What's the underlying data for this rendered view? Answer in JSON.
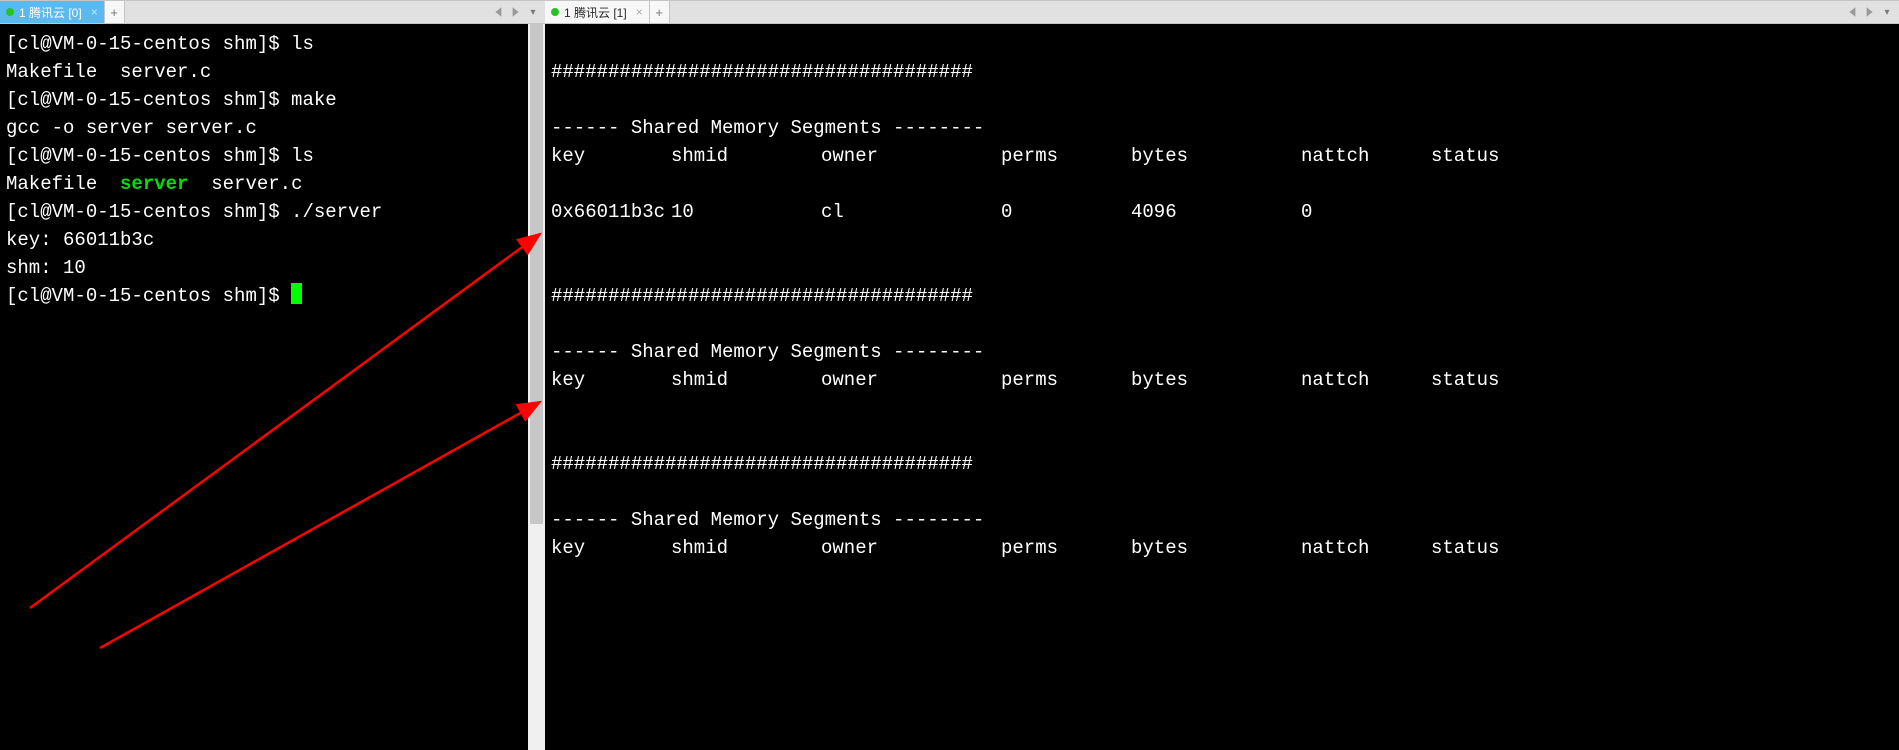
{
  "tabs": {
    "left": {
      "label": "1 腾讯云 [0]"
    },
    "right": {
      "label": "1 腾讯云 [1]"
    }
  },
  "left_terminal": {
    "prompt": "[cl@VM-0-15-centos shm]$ ",
    "lines": {
      "l1_cmd": "ls",
      "l2": "Makefile  server.c",
      "l3_cmd": "make",
      "l4": "gcc -o server server.c",
      "l5_cmd": "ls",
      "l6_pre": "Makefile  ",
      "l6_green": "server",
      "l6_post": "  server.c",
      "l7_cmd": "./server",
      "l8": "key: 66011b3c",
      "l9": "shm: 10"
    }
  },
  "right_terminal": {
    "div": "#####################################",
    "seg_header": "------ Shared Memory Segments --------",
    "cols": {
      "key": "key",
      "shmid": "shmid",
      "owner": "owner",
      "perms": "perms",
      "bytes": "bytes",
      "nattch": "nattch",
      "status": "status"
    },
    "row": {
      "key": "0x66011b3c",
      "shmid": "10",
      "owner": "cl",
      "perms": "0",
      "bytes": "4096",
      "nattch": "0",
      "status": ""
    }
  }
}
